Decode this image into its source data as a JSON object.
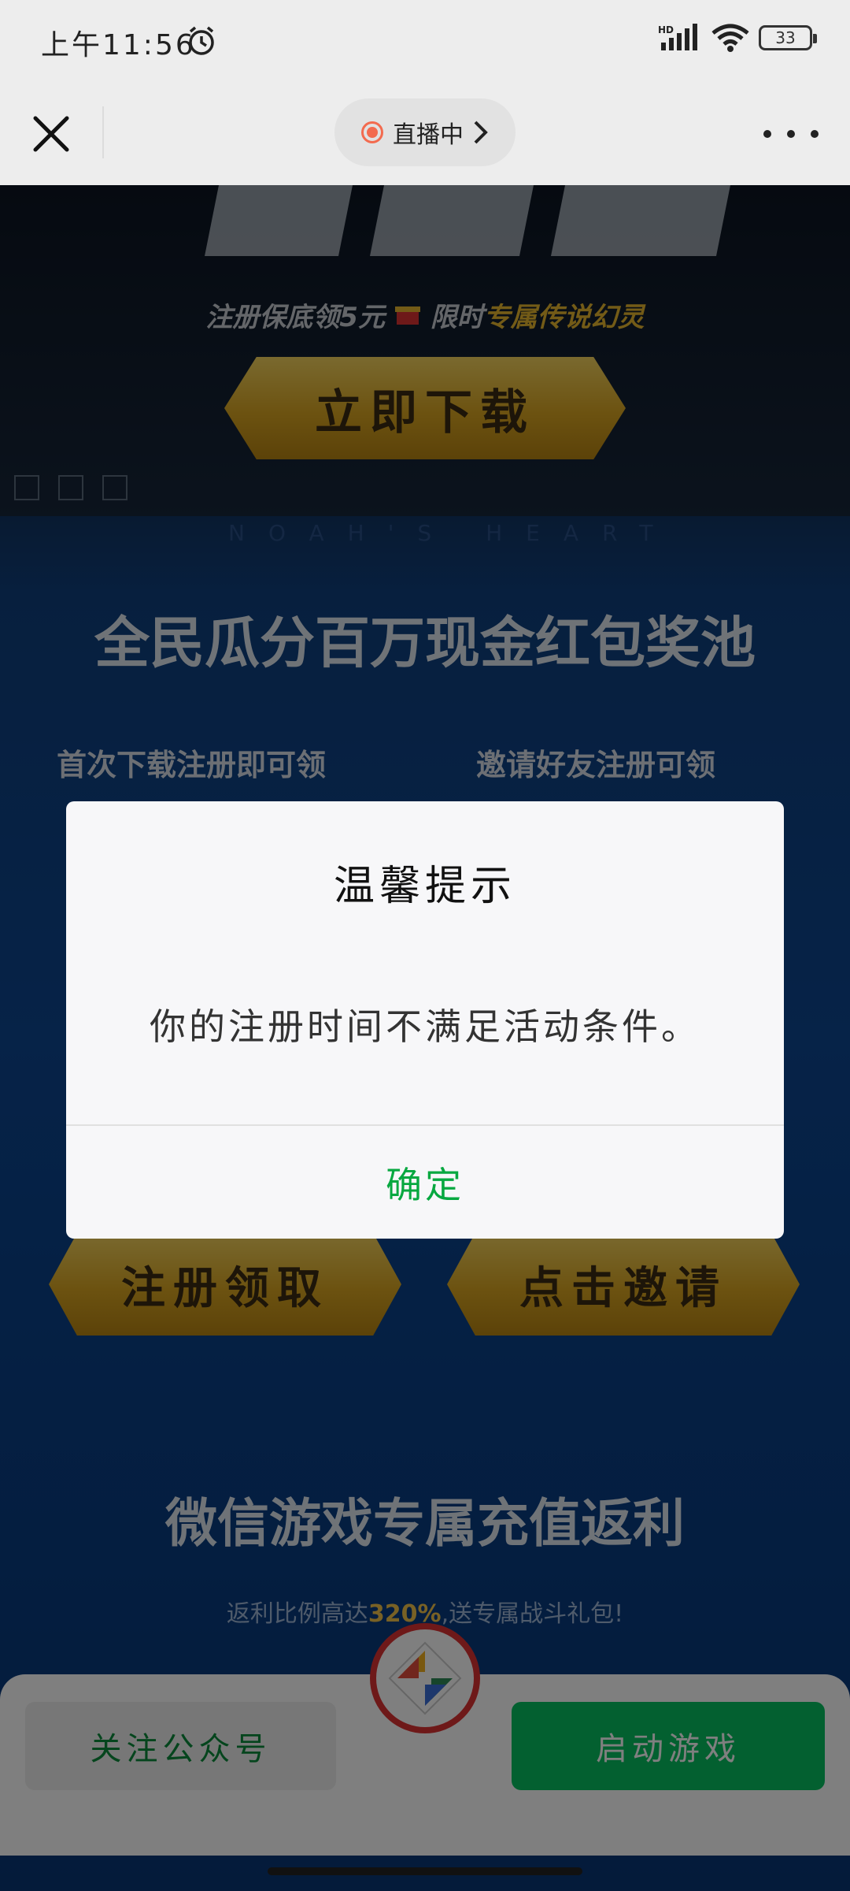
{
  "status_bar": {
    "time": "上午11:56",
    "battery": "33",
    "icons": [
      "alarm-icon",
      "hd-signal-icon",
      "wifi-icon",
      "battery-icon"
    ]
  },
  "title_bar": {
    "live_label": "直播中",
    "icons": [
      "close-icon",
      "live-dot-icon",
      "chevron-right-icon",
      "more-icon"
    ]
  },
  "page": {
    "promo_pre": "注册保底领5元",
    "promo_accent_pre": "限时",
    "promo_accent": "专属传说幻灵",
    "download_label": "立即下载",
    "section1_title": "全民瓜分百万现金红包奖池",
    "col_left_label": "首次下载注册即可领",
    "col_right_label": "邀请好友注册可领",
    "register_label": "注册领取",
    "invite_label": "点击邀请",
    "section2_title": "微信游戏专属充值返利",
    "rebate_pre": "返利比例高达",
    "rebate_pct": "320%",
    "rebate_post": ",送专属战斗礼包!"
  },
  "bottom_bar": {
    "follow_label": "关注公众号",
    "launch_label": "启动游戏"
  },
  "dialog": {
    "title": "温馨提示",
    "message": "你的注册时间不满足活动条件。",
    "confirm_label": "确定"
  },
  "colors": {
    "accent_green": "#07c160",
    "live_red": "#f36b4f",
    "gold": "#e6b62e"
  }
}
